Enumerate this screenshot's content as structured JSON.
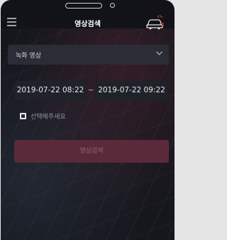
{
  "header": {
    "title": "영상검색"
  },
  "select": {
    "value": "녹화 영상"
  },
  "dates": {
    "start": "2019-07-22 08:22",
    "separator": "~",
    "end": "2019-07-22 09:22"
  },
  "checkbox": {
    "label": "선택해주세요"
  },
  "search_button": {
    "label": "영상검색"
  },
  "colors": {
    "background": "#111318",
    "field": "#2a2d36",
    "button": "#5a2a3a",
    "car_accent": "#d62c3b"
  },
  "icons": {
    "menu": "hamburger-menu-icon",
    "car": "car-alert-icon",
    "dropdown": "chevron-down-icon"
  }
}
